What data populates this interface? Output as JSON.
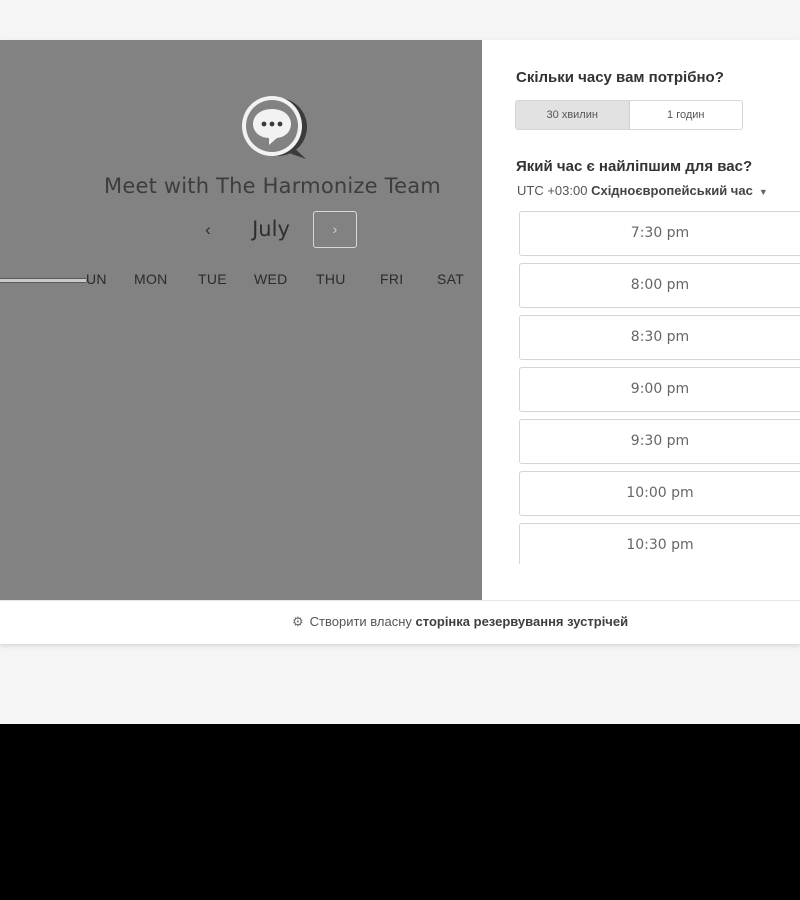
{
  "calendar": {
    "meeting_title": "Meet with The Harmonize Team",
    "month": "July",
    "prev_icon": "‹",
    "next_icon": "›",
    "weekdays": [
      "UN",
      "MON",
      "TUE",
      "WED",
      "THU",
      "FRI",
      "SAT"
    ]
  },
  "scheduler": {
    "duration_question": "Скільки часу вам потрібно?",
    "duration_options": [
      "30 хвилин",
      "1 годин"
    ],
    "selected_duration": "30 хвилин",
    "time_question": "Який час є найліпшим для вас?",
    "timezone_offset": "UTC +03:00",
    "timezone_name": "Східноєвропейський час",
    "time_slots": [
      "7:30 pm",
      "8:00 pm",
      "8:30 pm",
      "9:00 pm",
      "9:30 pm",
      "10:00 pm",
      "10:30 pm"
    ]
  },
  "footer": {
    "prefix": "Створити власну",
    "link": "сторінка резервування зустрічей",
    "icon": "hubspot-sprocket-icon"
  },
  "colors": {
    "left_panel_bg": "#828282",
    "page_bg": "#f5f5f5",
    "letterbox": "#000000"
  }
}
